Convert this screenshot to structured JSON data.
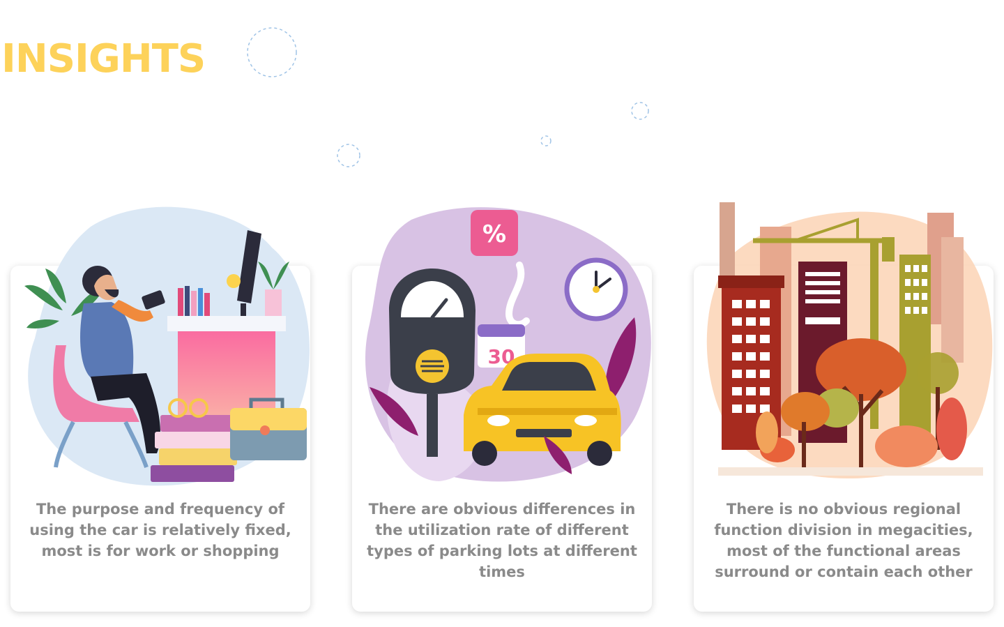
{
  "page": {
    "title": "INSIGHTS",
    "accent_color": "#FDD25A",
    "text_color": "#8a8a8a"
  },
  "cards": [
    {
      "text": "The purpose and frequency of using the car is relatively fixed, most is for work or shopping",
      "illustration_icon": "person-at-desk-icon"
    },
    {
      "text": "There are obvious differences in the utilization rate of different types of parking lots at different times",
      "illustration_icon": "parking-meter-car-icon",
      "percent_sign": "%",
      "calendar_day": "30"
    },
    {
      "text": "There is no obvious regional function division in megacities, most of the functional areas surround or contain each other",
      "illustration_icon": "city-buildings-icon"
    }
  ]
}
